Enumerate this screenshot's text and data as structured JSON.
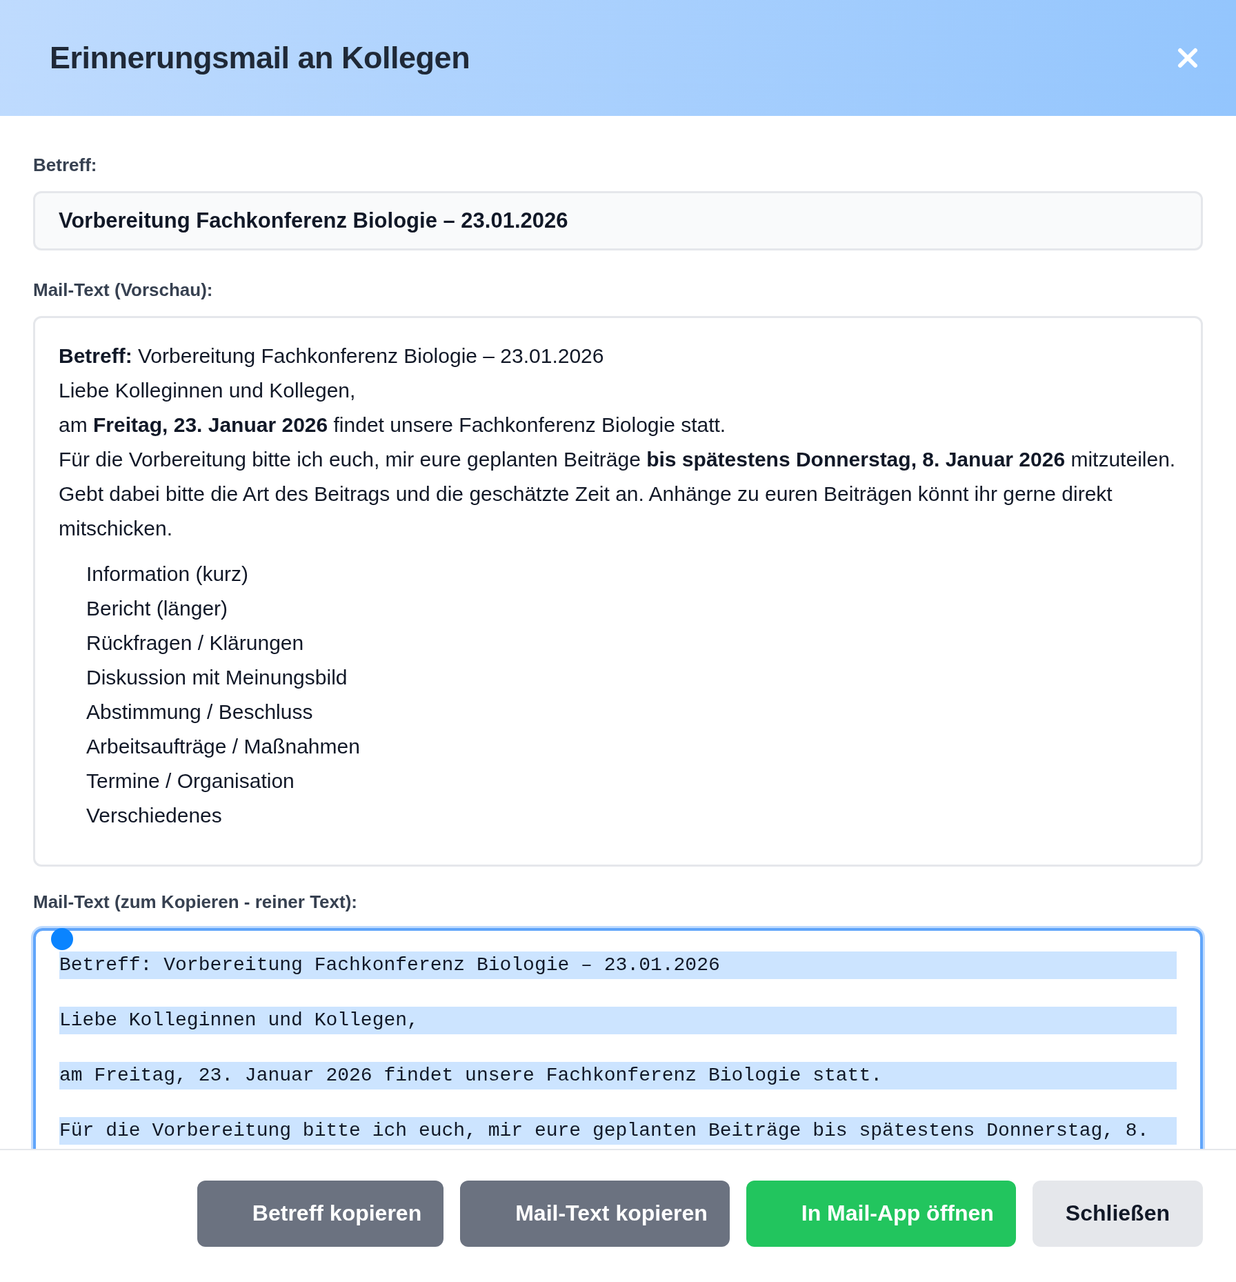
{
  "dialog": {
    "title": "Erinnerungsmail an Kollegen"
  },
  "subject": {
    "label": "Betreff:",
    "value": "Vorbereitung Fachkonferenz Biologie – 23.01.2026"
  },
  "preview": {
    "label": "Mail-Text (Vorschau):",
    "paragraphs": [
      "**Betreff:** Vorbereitung Fachkonferenz Biologie – 23.01.2026",
      "Liebe Kolleginnen und Kollegen,",
      "am **Freitag, 23. Januar 2026** findet unsere Fachkonferenz Biologie statt.",
      "Für die Vorbereitung bitte ich euch, mir eure geplanten Beiträge **bis spätestens Donnerstag, 8. Januar 2026** mitzuteilen.",
      "Gebt dabei bitte die Art des Beitrags und die geschätzte Zeit an. Anhänge zu euren Beiträgen könnt ihr gerne direkt mitschicken."
    ],
    "list": [
      "Information (kurz)",
      "Bericht (länger)",
      "Rückfragen / Klärungen",
      "Diskussion mit Meinungsbild",
      "Abstimmung / Beschluss",
      "Arbeitsaufträge / Maßnahmen",
      "Termine / Organisation",
      "Verschiedenes"
    ]
  },
  "plain_text": {
    "label": "Mail-Text (zum Kopieren - reiner Text):",
    "selected": true,
    "lines": [
      "Betreff: Vorbereitung Fachkonferenz Biologie – 23.01.2026",
      "Liebe Kolleginnen und Kollegen,",
      "am Freitag, 23. Januar 2026 findet unsere Fachkonferenz Biologie statt.",
      "Für die Vorbereitung bitte ich euch, mir eure geplanten Beiträge bis spätestens Donnerstag, 8."
    ]
  },
  "buttons": [
    {
      "kind": "secondary",
      "label": "Betreff kopieren"
    },
    {
      "kind": "secondary",
      "label": "Mail-Text kopieren"
    },
    {
      "kind": "primary",
      "label": "In Mail-App öffnen"
    },
    {
      "kind": "neutral",
      "label": "Schließen"
    }
  ]
}
